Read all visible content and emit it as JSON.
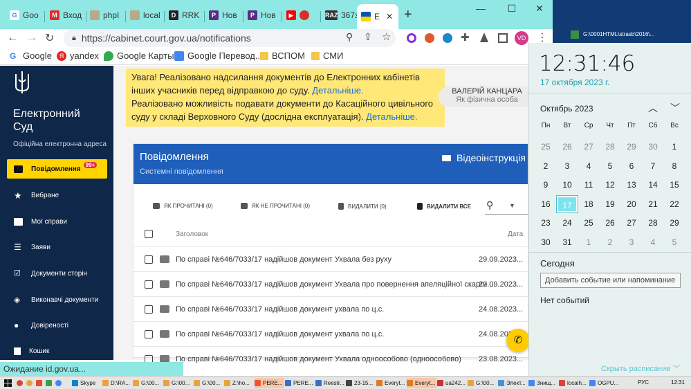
{
  "browser": {
    "tabs": [
      "Goo",
      "Вход",
      "phpI",
      "local",
      "RRK",
      "Нов",
      "Нов",
      "",
      "367з",
      "Е"
    ],
    "new_tab": "+",
    "url": "https://cabinet.court.gov.ua/notifications",
    "profile": "VD",
    "win_controls": [
      "—",
      "☐",
      "✕"
    ]
  },
  "bookmarks": [
    "Google",
    "yandex",
    "Google Карты",
    "Google Перевод...",
    "ВСПОМ",
    "СМИ"
  ],
  "desktop": {
    "label": "G:\\0001HTML\\strasb\\2016\\..."
  },
  "sidebar": {
    "title_line1": "Електронний",
    "title_line2": "Суд",
    "subtitle": "Офіційна електронна адреса",
    "items": [
      {
        "label": "Повідомлення",
        "badge": "99+",
        "icon": "chat-icon"
      },
      {
        "label": "Вибране",
        "icon": "star-icon"
      },
      {
        "label": "Мої справи",
        "icon": "folder-icon"
      },
      {
        "label": "Заяви",
        "icon": "list-icon"
      },
      {
        "label": "Документи сторін",
        "icon": "checklist-icon"
      },
      {
        "label": "Виконавчі документи",
        "icon": "layers-icon"
      },
      {
        "label": "Довіреності",
        "icon": "person-icon"
      },
      {
        "label": "Кошик",
        "icon": "trash-icon"
      }
    ]
  },
  "notice": {
    "line1": "Увага! Реалізовано надсилання документів до Електронних кабінетів інших учасників перед відправкою до суду.",
    "link1": "Детальніше.",
    "line2": "Реалізовано можливість подавати документи до Касаційного цивільного суду у складі Верховного Суду (дослідна експлуатація).",
    "link2": "Детальніше."
  },
  "user": {
    "name": "ВАЛЕРІЙ КАНЦАРА",
    "role": "Як фізична особа"
  },
  "panel": {
    "title": "Повідомлення",
    "subtitle": "Системні повідомлення",
    "video": "Відеоінструкція",
    "actions": [
      "ЯК ПРОЧИТАНІ (0)",
      "ЯК НЕ ПРОЧИТАНІ (0)",
      "ВИДАЛИТИ (0)",
      "ВИДАЛИТИ ВСЕ"
    ],
    "col_title": "Заголовок",
    "col_date": "Дата",
    "rows": [
      {
        "title": "По справі №646/7033/17 надійшов документ Ухвала без руху",
        "date": "29.09.2023..."
      },
      {
        "title": "По справі №646/7033/17 надійшов документ Ухвала про повернення апеляційної скарги ...",
        "date": "29.09.2023..."
      },
      {
        "title": "По справі №646/7033/17 надійшов документ ухвала по ц.с.",
        "date": "24.08.2023..."
      },
      {
        "title": "По справі №646/7033/17 надійшов документ ухвала по ц.с.",
        "date": "24.08.2023..."
      },
      {
        "title": "По справі №646/7033/17 надійшов документ Ухвала одноособово (одноособово)",
        "date": "23.08.2023..."
      }
    ]
  },
  "status_bar": "Ожидание id.gov.ua...",
  "calendar": {
    "time": "12:31:46",
    "date": "17 октября 2023 г.",
    "month": "Октябрь 2023",
    "weekdays": [
      "Пн",
      "Вт",
      "Ср",
      "Чт",
      "Пт",
      "Сб",
      "Вс"
    ],
    "weeks": [
      [
        "25",
        "26",
        "27",
        "28",
        "29",
        "30",
        "1"
      ],
      [
        "2",
        "3",
        "4",
        "5",
        "6",
        "7",
        "8"
      ],
      [
        "9",
        "10",
        "11",
        "12",
        "13",
        "14",
        "15"
      ],
      [
        "16",
        "17",
        "18",
        "19",
        "20",
        "21",
        "22"
      ],
      [
        "23",
        "24",
        "25",
        "26",
        "27",
        "28",
        "29"
      ],
      [
        "30",
        "31",
        "1",
        "2",
        "3",
        "4",
        "5"
      ]
    ],
    "today": "Сегодня",
    "add_event": "Добавить событие или напоминание",
    "no_events": "Нет событий",
    "hide": "Скрыть расписание"
  },
  "taskbar": {
    "items": [
      "Skype",
      "D:\\RA...",
      "G:\\00...",
      "G:\\00...",
      "G:\\00...",
      "Z:\\ho...",
      "PERE...",
      "PERE...",
      "Reestr...",
      "23-15...",
      "Everyt...",
      "Everyt...",
      "ua242...",
      "G:\\00...",
      "Элект...",
      "Знищ...",
      "localh...",
      "OGPU..."
    ],
    "lang": "РУС",
    "clock": "12:31"
  },
  "colors": {
    "sidebar": "#0f2748",
    "accent": "#ffd400",
    "header": "#1f5fb9",
    "notice": "#ffe778",
    "calendar_today": "#7de3ee",
    "fab": "#ffcc00"
  }
}
